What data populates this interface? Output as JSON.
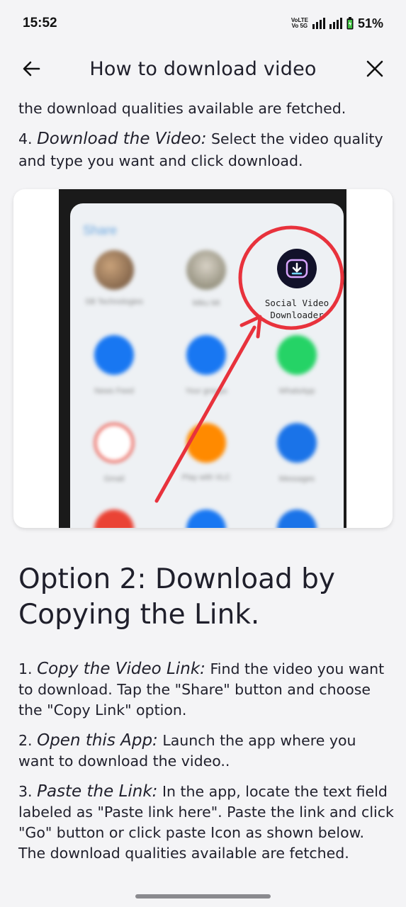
{
  "status_bar": {
    "time": "15:52",
    "volte_line1": "VoLTE",
    "volte_line2": "Vo 5G",
    "battery": "51%"
  },
  "app_bar": {
    "back_icon": "arrow-left-icon",
    "title": "How to download video",
    "close_icon": "close-icon"
  },
  "intro": {
    "line": "the download qualities available are fetched.",
    "step4_num": "4.",
    "step4_title": "Download the Video:",
    "step4_text": "Select the video quality and type you want and click download."
  },
  "screenshot": {
    "share_title": "Share",
    "apps": [
      {
        "label": "SB Technologies"
      },
      {
        "label": "Miku Mt"
      },
      {
        "label": "Social Video Downloader"
      },
      {
        "label": "News Feed"
      },
      {
        "label": "Your groups"
      },
      {
        "label": "WhatsApp"
      },
      {
        "label": "Gmail"
      },
      {
        "label": "Play with VLC"
      },
      {
        "label": "Messages"
      }
    ],
    "highlight_color": "#e8323c"
  },
  "option2": {
    "heading": "Option 2: Download by Copying the Link.",
    "steps": [
      {
        "num": "1.",
        "title": "Copy the Video Link:",
        "text": "Find the video you want to download. Tap the \"Share\" button and choose the \"Copy Link\" option."
      },
      {
        "num": "2.",
        "title": "Open this App:",
        "text": "Launch the app where you want to download the video.."
      },
      {
        "num": "3.",
        "title": "Paste the Link:",
        "text": "In the app, locate the text field labeled as \"Paste link here\". Paste the link and click \"Go\" button or click paste Icon as shown below. The download qualities available are fetched."
      }
    ]
  }
}
